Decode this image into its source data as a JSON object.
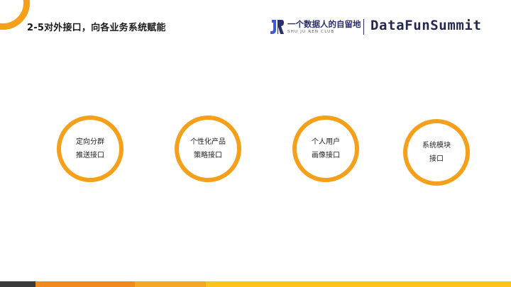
{
  "header": {
    "title": "2-5对外接口，向各业务系统赋能",
    "logo_cn": "一个数据人的自留地",
    "logo_en": "SHU JU REN CLUB",
    "brand": "DataFunSummit"
  },
  "nodes": [
    {
      "line1": "定向分群",
      "line2": "推送接口"
    },
    {
      "line1": "个性化产品",
      "line2": "策略接口"
    },
    {
      "line1": "个人用户",
      "line2": "画像接口"
    },
    {
      "line1": "系统模块",
      "line2": "接口"
    }
  ],
  "colors": {
    "accent": "#f5a01a",
    "footer": [
      "#3a3a3a",
      "#f08a1c",
      "#f5a623",
      "#ffc21a"
    ]
  }
}
